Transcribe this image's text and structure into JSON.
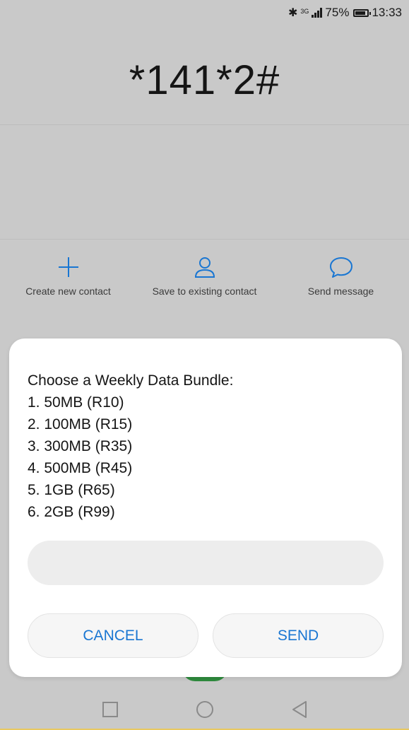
{
  "status_bar": {
    "bluetooth_icon": "bluetooth-icon",
    "network_type": "3G",
    "battery": "75%",
    "time": "13:33"
  },
  "dialer": {
    "number": "*141*2#"
  },
  "actions": [
    {
      "icon": "plus-icon",
      "label": "Create new contact"
    },
    {
      "icon": "person-icon",
      "label": "Save to existing contact"
    },
    {
      "icon": "chat-bubble-icon",
      "label": "Send message"
    }
  ],
  "dialog": {
    "lines": [
      "Choose a Weekly Data Bundle:",
      "1. 50MB (R10)",
      "2. 100MB (R15)",
      "3. 300MB (R35)",
      "4. 500MB (R45)",
      "5. 1GB (R65)",
      "6. 2GB (R99)"
    ],
    "input_value": "",
    "cancel_label": "CANCEL",
    "send_label": "SEND"
  },
  "colors": {
    "accent": "#1976d2",
    "background": "#c9c9c9"
  }
}
